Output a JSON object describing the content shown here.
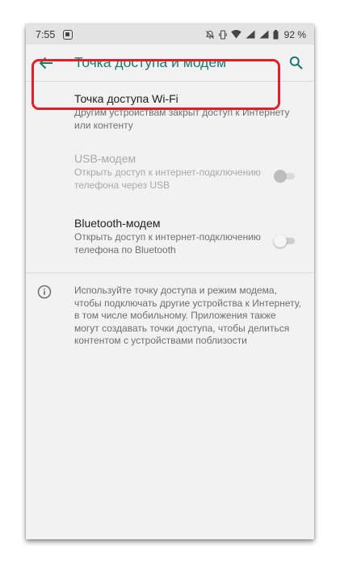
{
  "status_bar": {
    "time": "7:55",
    "battery_percent": "92 %"
  },
  "app_bar": {
    "title": "Точка доступа и модем"
  },
  "items": [
    {
      "title": "Точка доступа Wi-Fi",
      "summary": "Другим устройствам закрыт доступ к Интернету или контенту"
    },
    {
      "title": "USB-модем",
      "summary": "Открыть доступ к интернет-подключению телефона через USB",
      "enabled": false,
      "checked": false
    },
    {
      "title": "Bluetooth-модем",
      "summary": "Открыть доступ к интернет-подключению телефона по Bluetooth",
      "enabled": true,
      "checked": false
    }
  ],
  "info_text": "Используйте точку доступа и режим модема, чтобы подключать другие устройства к Интернету, в том числе мобильному. Приложения также могут создавать точки доступа, чтобы делиться контентом с устройствами поблизости",
  "colors": {
    "accent": "#1b7a6d",
    "highlight": "#e0202a"
  },
  "icons": {
    "back": "arrow-back-icon",
    "search": "search-icon",
    "info": "info-icon"
  }
}
